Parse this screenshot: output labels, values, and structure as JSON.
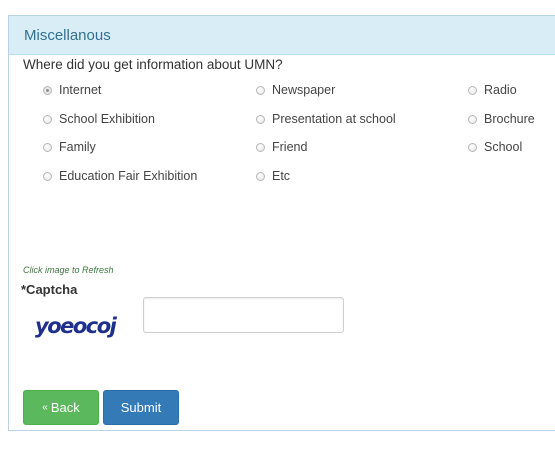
{
  "panel": {
    "title": "Miscellanous"
  },
  "question": "Where did you get information about UMN?",
  "options": [
    {
      "label": "Internet",
      "checked": true
    },
    {
      "label": "Newspaper",
      "checked": false
    },
    {
      "label": "Radio",
      "checked": false
    },
    {
      "label": "School Exhibition",
      "checked": false
    },
    {
      "label": "Presentation at school",
      "checked": false
    },
    {
      "label": "Brochure",
      "checked": false
    },
    {
      "label": "Family",
      "checked": false
    },
    {
      "label": "Friend",
      "checked": false
    },
    {
      "label": "School",
      "checked": false
    },
    {
      "label": "Education Fair Exhibition",
      "checked": false
    },
    {
      "label": "Etc",
      "checked": false
    }
  ],
  "captcha": {
    "refresh_hint": "Click image to Refresh",
    "label": "*Captcha",
    "image_text": "yoeocoj",
    "input_value": ""
  },
  "buttons": {
    "back_arrow": "«",
    "back_label": "Back",
    "submit_label": "Submit"
  },
  "colors": {
    "header_bg": "#d9edf7",
    "header_text": "#31708f",
    "back_button": "#5cb85c",
    "submit_button": "#337ab7",
    "captcha_text": "#1e2f8c"
  }
}
